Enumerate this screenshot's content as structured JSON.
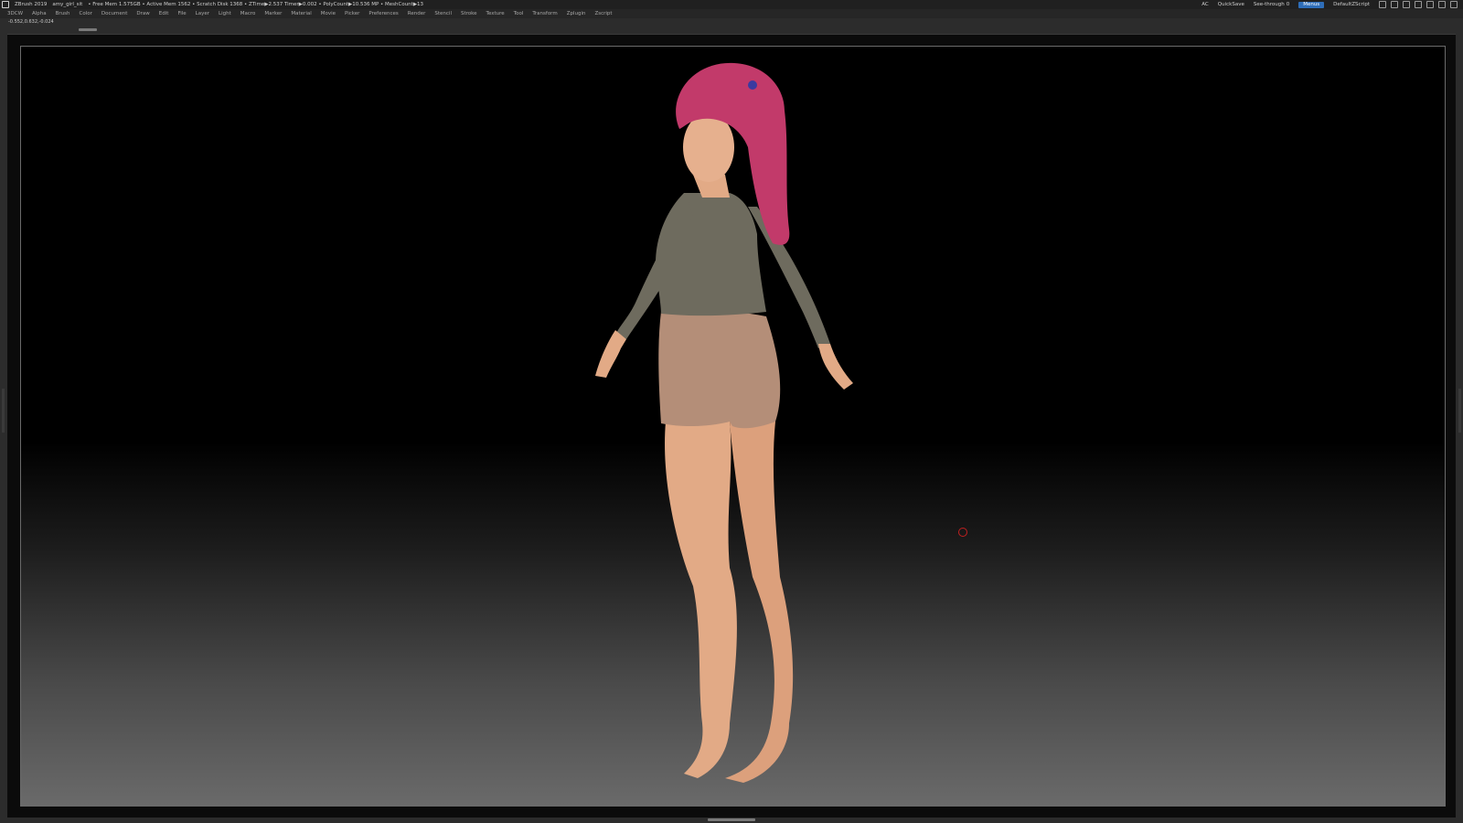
{
  "titlebar": {
    "app": "ZBrush 2019",
    "document": "amy_girl_sit",
    "stats": "• Free Mem 1.575GB • Active Mem 1562 • Scratch Disk 1368 •  ZTime▶2.537 Timer▶0.002 • PolyCount▶10.536 MP  • MeshCount▶13",
    "ac": "AC",
    "quicksave": "QuickSave",
    "see_through_label": "See-through",
    "see_through_value": "0",
    "menus_button": "Menus",
    "script": "DefaultZScript"
  },
  "menus": [
    "3DCW",
    "Alpha",
    "Brush",
    "Color",
    "Document",
    "Draw",
    "Edit",
    "File",
    "Layer",
    "Light",
    "Macro",
    "Marker",
    "Material",
    "Movie",
    "Picker",
    "Preferences",
    "Render",
    "Stencil",
    "Stroke",
    "Texture",
    "Tool",
    "Transform",
    "Zplugin",
    "Zscript"
  ],
  "coordinates": "-0.552,0.632,-0.024",
  "colors": {
    "accent": "#2e6db8",
    "hair": "#c23a6a",
    "top": "#6e6b5e",
    "shorts": "#b48e78",
    "skin": "#e8b08c"
  }
}
